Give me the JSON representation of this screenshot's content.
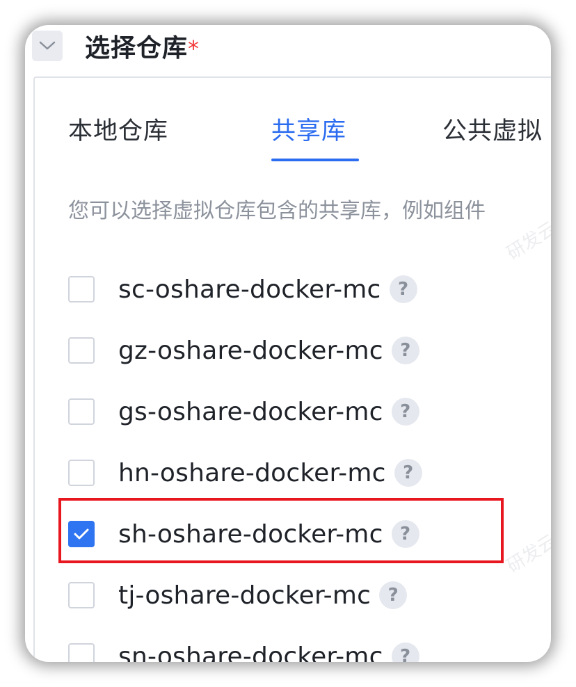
{
  "section": {
    "title": "选择仓库",
    "required_mark": "*",
    "collapse_icon": "chevron-down-icon"
  },
  "tabs": [
    {
      "label": "本地仓库",
      "active": false
    },
    {
      "label": "共享库",
      "active": true
    },
    {
      "label": "公共虚拟",
      "active": false
    }
  ],
  "description": "您可以选择虚拟仓库包含的共享库，例如组件",
  "watermark": "研发云",
  "repos": [
    {
      "name": "sc-oshare-docker-mc",
      "checked": false
    },
    {
      "name": "gz-oshare-docker-mc",
      "checked": false
    },
    {
      "name": "gs-oshare-docker-mc",
      "checked": false
    },
    {
      "name": "hn-oshare-docker-mc",
      "checked": false
    },
    {
      "name": "sh-oshare-docker-mc",
      "checked": true
    },
    {
      "name": "tj-oshare-docker-mc",
      "checked": false
    },
    {
      "name": "sn-oshare-docker-mc",
      "checked": false
    }
  ],
  "help_glyph": "?",
  "colors": {
    "accent": "#2b6cf0",
    "highlight": "#e8161e",
    "required": "#f23c3c"
  }
}
